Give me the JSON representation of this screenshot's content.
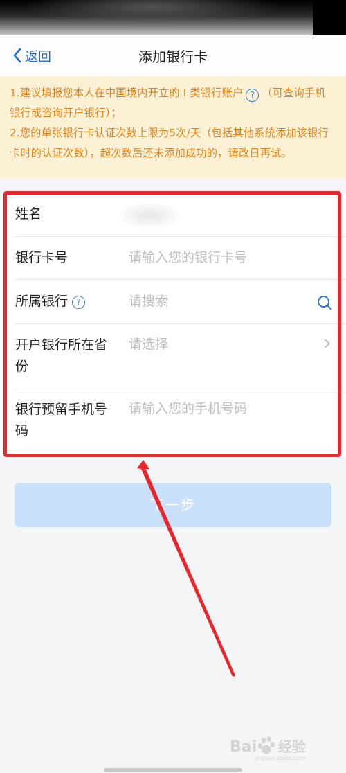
{
  "nav": {
    "back_label": "返回",
    "title": "添加银行卡"
  },
  "notice": {
    "line1_pre": "1.建议填报您本人在中国境内开立的 I 类银行账户",
    "line1_post": "（可查询手机银行或咨询开户银行）；",
    "line2": "2.您的单张银行卡认证次数上限为5次/天（包括其他系统添加该银行卡时的认证次数），超次数后还未添加成功的，请改日再试。",
    "help_glyph": "?"
  },
  "form": {
    "name_label": "姓名",
    "card_label": "银行卡号",
    "card_placeholder": "请输入您的银行卡号",
    "bank_label": "所属银行",
    "bank_help_glyph": "?",
    "bank_placeholder": "请搜索",
    "province_label": "开户银行所在省份",
    "province_placeholder": "请选择",
    "phone_label": "银行预留手机号码",
    "phone_placeholder": "请输入您的手机号码"
  },
  "next_button_label": "下一步",
  "icons": {
    "back": "chevron-left-icon",
    "help": "question-circle-icon",
    "search": "search-icon",
    "select": "chevron-right-icon"
  },
  "colors": {
    "accent": "#1f6ad6",
    "notice_bg": "#fdf1d5",
    "notice_text": "#e0831c",
    "highlight": "#e8262b",
    "button_disabled": "#c9e1fa"
  },
  "watermark": {
    "brand": "Bai",
    "suffix": "经验",
    "domain": "jingyan.baidu.com"
  }
}
